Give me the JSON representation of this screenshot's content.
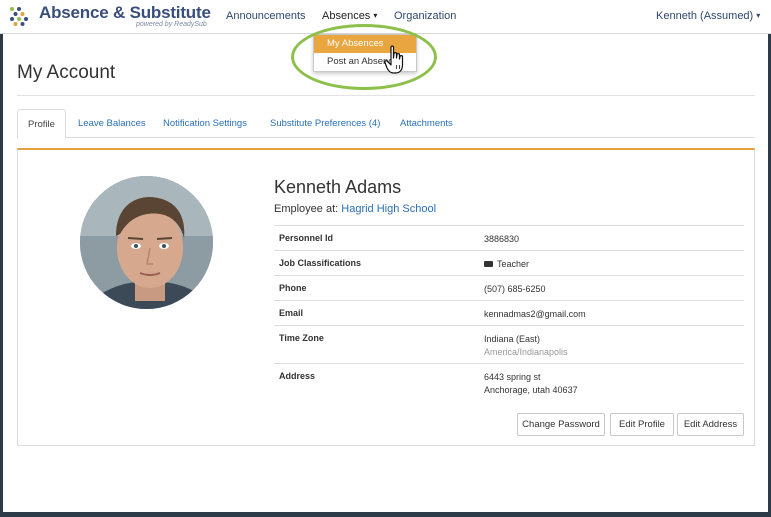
{
  "brand": {
    "name": "Absence & Substitute",
    "tagline": "powered by ReadySub"
  },
  "nav": {
    "announcements": "Announcements",
    "absences": "Absences",
    "organization": "Organization",
    "user": "Kenneth (Assumed)"
  },
  "absences_menu": {
    "items": [
      "My Absences",
      "Post an Absence"
    ],
    "selected": "My Absences"
  },
  "page": {
    "title": "My Account"
  },
  "tabs": [
    {
      "label": "Profile",
      "active": true
    },
    {
      "label": "Leave Balances",
      "active": false
    },
    {
      "label": "Notification Settings",
      "active": false
    },
    {
      "label": "Substitute Preferences (4)",
      "active": false
    },
    {
      "label": "Attachments",
      "active": false
    }
  ],
  "profile": {
    "name": "Kenneth Adams",
    "employee_prefix": "Employee at:",
    "school": "Hagrid High School",
    "fields": [
      {
        "label": "Personnel Id",
        "value": "3886830"
      },
      {
        "label": "Job Classifications",
        "value": "Teacher"
      },
      {
        "label": "Phone",
        "value": "(507) 685-6250"
      },
      {
        "label": "Email",
        "value": "kennadmas2@gmail.com"
      },
      {
        "label": "Time Zone",
        "value": "Indiana (East)",
        "sub": "America/Indianapolis"
      },
      {
        "label": "Address",
        "value": "6443 spring st",
        "sub": "Anchorage, utah 40637"
      }
    ]
  },
  "actions": {
    "change_password": "Change Password",
    "edit_profile": "Edit Profile",
    "edit_address": "Edit Address"
  },
  "colors": {
    "accent": "#e9a53f",
    "link": "#2a6fb3",
    "brand": "#3a4e7c",
    "highlight": "#8cc04b"
  }
}
